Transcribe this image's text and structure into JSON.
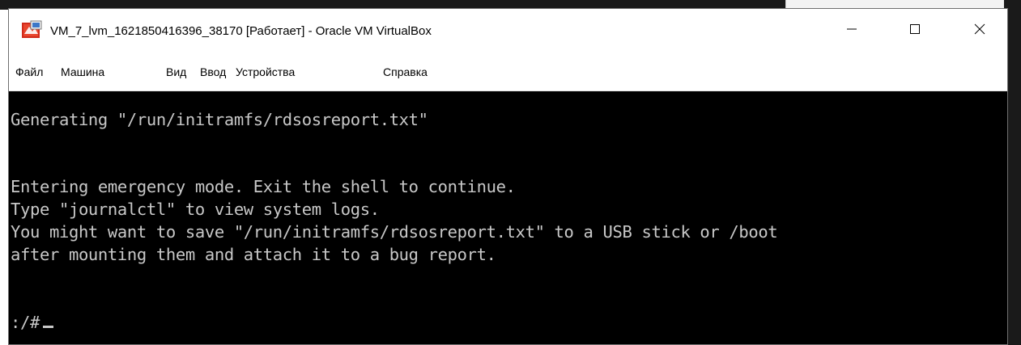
{
  "window": {
    "title": "VM_7_lvm_1621850416396_38170 [Работает] - Oracle VM VirtualBox",
    "controls": {
      "minimize_icon": "minimize-icon",
      "maximize_icon": "maximize-icon",
      "close_icon": "close-icon"
    },
    "app_icon": "virtualbox-icon"
  },
  "menubar": {
    "items": [
      {
        "label": "Файл"
      },
      {
        "label": "Машина"
      },
      {
        "label": "Вид"
      },
      {
        "label": "Ввод"
      },
      {
        "label": "Устройства"
      },
      {
        "label": "Справка"
      }
    ]
  },
  "console": {
    "lines": [
      "Generating \"/run/initramfs/rdsosreport.txt\"",
      "Entering emergency mode. Exit the shell to continue.",
      "Type \"journalctl\" to view system logs.",
      "You might want to save \"/run/initramfs/rdsosreport.txt\" to a USB stick or /boot",
      "after mounting them and attach it to a bug report.",
      ":/#"
    ],
    "background": "#000000",
    "foreground": "#c8c8c8"
  }
}
